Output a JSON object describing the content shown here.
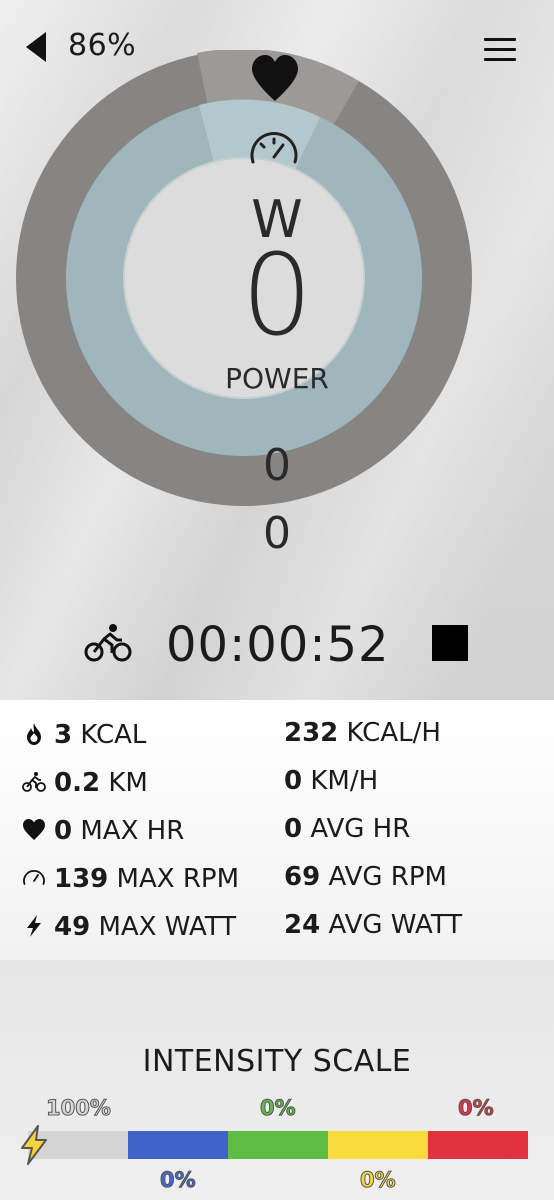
{
  "status": {
    "battery": "86%",
    "icons": [
      "back-arrow-icon",
      "menu-icon"
    ]
  },
  "gauge": {
    "unit": "W",
    "value": "0",
    "label": "POWER",
    "inner_value": "0",
    "outer_value": "0",
    "icons": [
      "heart-icon",
      "speedometer-icon"
    ],
    "colors": {
      "outer_ring": "#878584",
      "outer_highlight": "#9c9998",
      "middle_ring": "#9fb6bc",
      "middle_highlight": "#b3c8cd",
      "center": "#dcdcdc"
    }
  },
  "timer": {
    "elapsed": "00:00:52",
    "icons": [
      "bike-icon",
      "stop-icon"
    ]
  },
  "stats": {
    "left": [
      {
        "icon": "flame-icon",
        "value": "3",
        "unit": "KCAL"
      },
      {
        "icon": "bike-icon",
        "value": "0.2",
        "unit": "KM"
      },
      {
        "icon": "heart-icon",
        "value": "0",
        "unit": "MAX HR"
      },
      {
        "icon": "speedometer-icon",
        "value": "139",
        "unit": "MAX RPM"
      },
      {
        "icon": "bolt-icon",
        "value": "49",
        "unit": "MAX WATT"
      }
    ],
    "right": [
      {
        "value": "232",
        "unit": "KCAL/H"
      },
      {
        "value": "0",
        "unit": "KM/H"
      },
      {
        "value": "0",
        "unit": "AVG HR"
      },
      {
        "value": "69",
        "unit": "AVG RPM"
      },
      {
        "value": "24",
        "unit": "AVG WATT"
      }
    ]
  },
  "intensity": {
    "title": "INTENSITY SCALE",
    "zones": [
      {
        "percent": "100%",
        "color": "#d4d4d4"
      },
      {
        "percent": "0%",
        "color": "#3f63c9"
      },
      {
        "percent": "0%",
        "color": "#5fbd45"
      },
      {
        "percent": "0%",
        "color": "#f7dc3c"
      },
      {
        "percent": "0%",
        "color": "#e0333f"
      }
    ],
    "icon": "bolt-icon"
  }
}
